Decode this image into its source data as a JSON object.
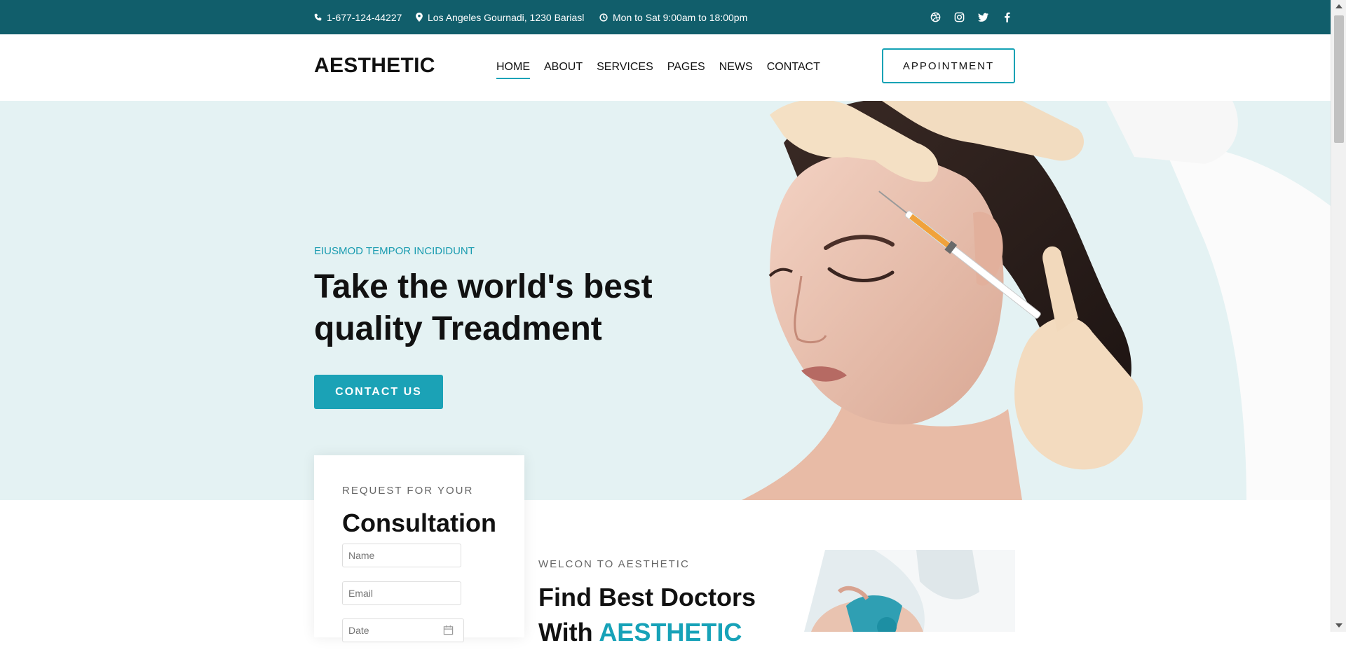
{
  "topbar": {
    "phone": "1-677-124-44227",
    "address": "Los Angeles Gournadi, 1230 Bariasl",
    "hours": "Mon to Sat 9:00am to 18:00pm",
    "social": [
      "dribbble-icon",
      "instagram-icon",
      "twitter-icon",
      "facebook-icon"
    ]
  },
  "header": {
    "logo": "AESTHETIC",
    "nav": [
      "HOME",
      "ABOUT",
      "SERVICES",
      "PAGES",
      "NEWS",
      "CONTACT"
    ],
    "active_nav": "HOME",
    "appointment_label": "APPOINTMENT"
  },
  "hero": {
    "eyebrow": "EIUSMOD TEMPOR INCIDIDUNT",
    "title": "Take the world's best quality Treadment",
    "button_label": "CONTACT US"
  },
  "consultation": {
    "eyebrow": "REQUEST FOR YOUR",
    "title": "Consultation",
    "name_placeholder": "Name",
    "email_placeholder": "Email",
    "date_placeholder": "Date"
  },
  "welcome": {
    "eyebrow": "WELCON TO AESTHETIC",
    "title_line1": "Find Best Doctors",
    "title_line2_prefix": "With ",
    "title_line2_accent": "AESTHETIC"
  },
  "colors": {
    "topbar_bg": "#115e6b",
    "accent": "#17a2b8",
    "hero_bg": "#e4f2f3"
  }
}
